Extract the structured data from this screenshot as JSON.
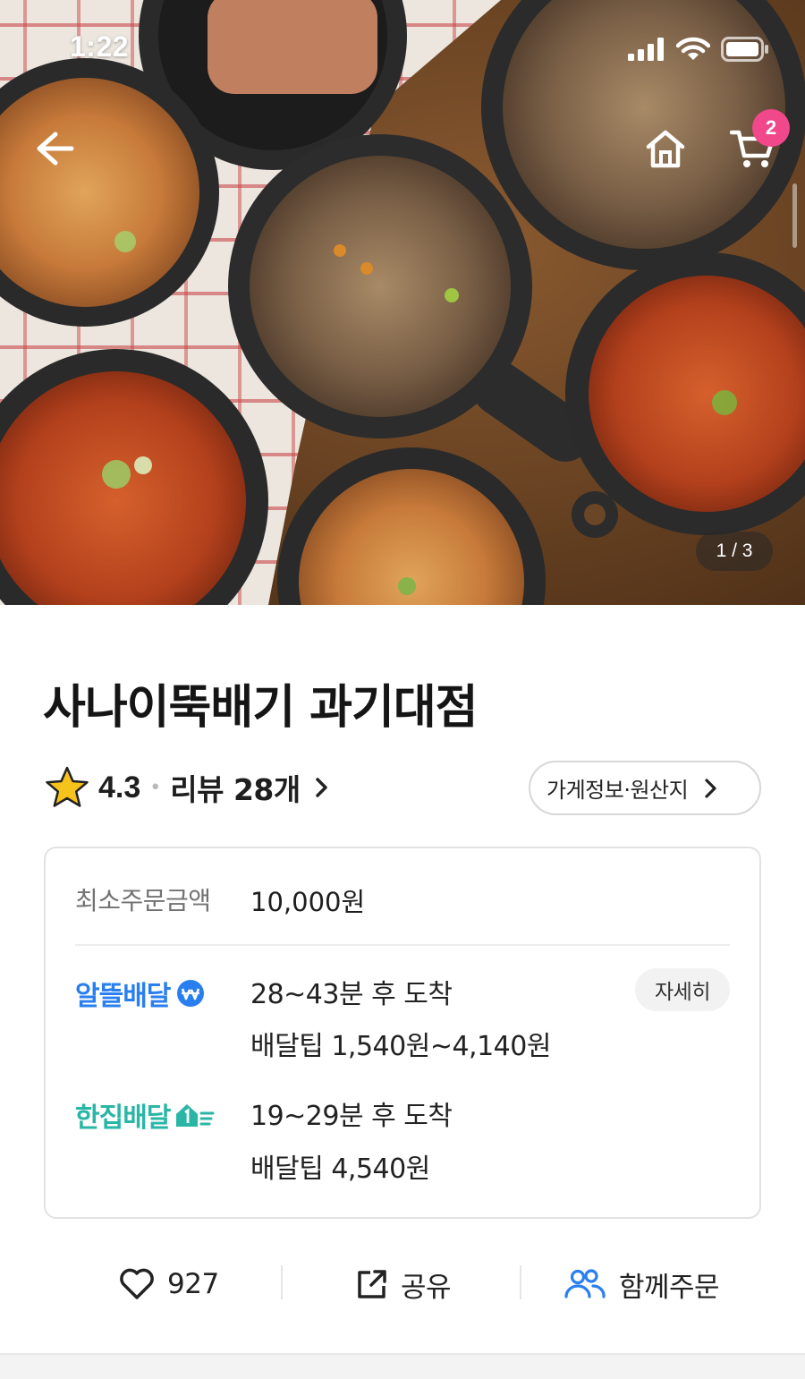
{
  "status_bar": {
    "time": "1:22"
  },
  "hero": {
    "page_indicator": "1 / 3",
    "cart_count": "2",
    "icons": {
      "back": "arrow-left-icon",
      "home": "home-icon",
      "cart": "cart-icon"
    }
  },
  "store": {
    "name": "사나이뚝배기 과기대점",
    "rating": "4.3",
    "review_label": "리뷰 28개",
    "info_chip": "가게정보·원산지"
  },
  "delivery": {
    "min_order_label": "최소주문금액",
    "min_order_value": "10,000원",
    "options": [
      {
        "brand": "알뜰배달",
        "time": "28~43분 후 도착",
        "tip": "배달팁 1,540원~4,140원",
        "detail_label": "자세히"
      },
      {
        "brand": "한집배달",
        "time": "19~29분 후 도착",
        "tip": "배달팁 4,540원"
      }
    ]
  },
  "actions": {
    "like_count": "927",
    "share_label": "공유",
    "group_order_label": "함께주문"
  },
  "colors": {
    "badge": "#f0488b",
    "altteul": "#2a7ff0",
    "hanjip": "#2ab6a6",
    "star": "#f6c31c"
  }
}
